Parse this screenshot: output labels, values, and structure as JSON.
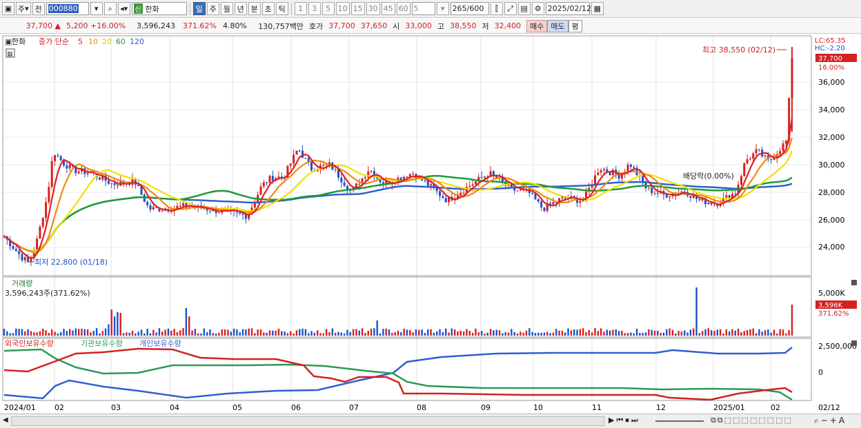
{
  "toolbar": {
    "period_week": "주",
    "prev": "전",
    "code": "000880",
    "sin": "신",
    "name": "한화",
    "periods": [
      "일",
      "주",
      "월",
      "년",
      "분",
      "초",
      "틱"
    ],
    "active_period": "일",
    "minute_options": [
      "1",
      "3",
      "5",
      "10",
      "15",
      "30",
      "45",
      "60"
    ],
    "interval": "5",
    "count": "265",
    "count_total": "/600",
    "date": "2025/02/12"
  },
  "quote": {
    "price": "37,700 ▲",
    "change": "5,200 +16.00%",
    "volume": "3,596,243",
    "volume_ratio": "371.62%",
    "turnover": "4.80%",
    "amount": "130,757백만",
    "hoga_label": "호가",
    "hoga_ask": "37,700",
    "hoga_bid": "37,650",
    "open_label": "시",
    "open": "33,000",
    "high_label": "고",
    "high": "38,550",
    "low_label": "저",
    "low": "32,400",
    "buy": "매수",
    "sell": "매도",
    "pyeong": "평"
  },
  "legend": {
    "name": "한화",
    "close_label": "종가 단순",
    "ma": [
      {
        "label": "5",
        "color": "#e02020"
      },
      {
        "label": "10",
        "color": "#f08a10"
      },
      {
        "label": "20",
        "color": "#f0e000"
      },
      {
        "label": "60",
        "color": "#1f9a3a"
      },
      {
        "label": "120",
        "color": "#2f5fd0"
      }
    ]
  },
  "annotations": {
    "high": "최고 38,550 (02/12)",
    "low": "최저 22,800 (01/18)",
    "dividend": "배당락(0.00%)"
  },
  "price_axis": {
    "lc": "LC:65.35",
    "hc": "HC:-2.20",
    "current": "37,700",
    "current_pct": "16.00%",
    "ticks": [
      "36,000",
      "34,000",
      "32,000",
      "30,000",
      "28,000",
      "26,000",
      "24,000"
    ]
  },
  "volume_panel": {
    "title": "거래량",
    "value": "3,596,243주(371.62%)",
    "tick": "5,000K",
    "current": "3,596K",
    "current_pct": "371.62%"
  },
  "holding_panel": {
    "foreign": "외국인보유수량",
    "institution": "기관보유수량",
    "individual": "개인보유수량",
    "ticks": [
      "2,500,000",
      "0"
    ]
  },
  "x_axis": [
    "2024/01",
    "02",
    "03",
    "04",
    "05",
    "06",
    "07",
    "08",
    "09",
    "10",
    "11",
    "12",
    "2025/01",
    "02"
  ],
  "x_end": "02/12",
  "colors": {
    "up": "#d42020",
    "down": "#1e50c8"
  }
}
